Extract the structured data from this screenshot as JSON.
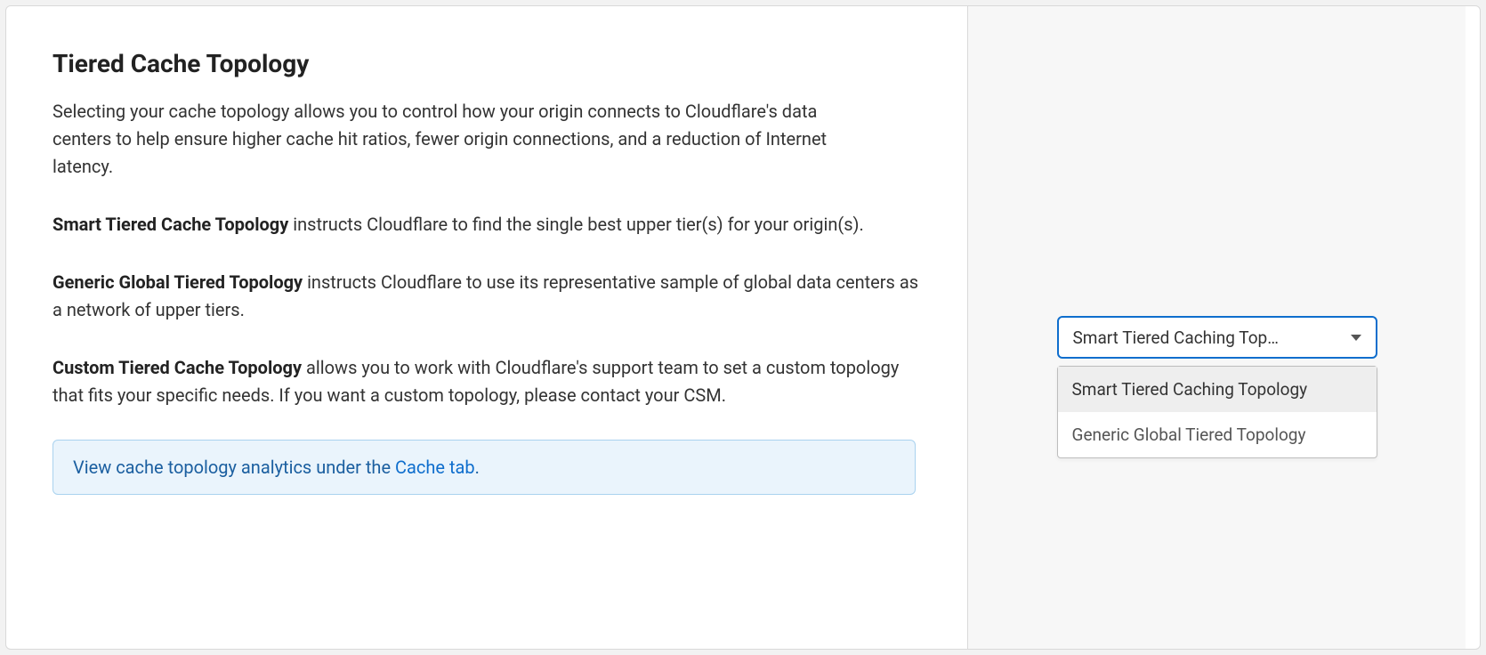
{
  "title": "Tiered Cache Topology",
  "description": "Selecting your cache topology allows you to control how your origin connects to Cloudflare's data centers to help ensure higher cache hit ratios, fewer origin connections, and a reduction of Internet latency.",
  "paragraphs": [
    {
      "bold": "Smart Tiered Cache Topology",
      "rest": " instructs Cloudflare to find the single best upper tier(s) for your origin(s)."
    },
    {
      "bold": "Generic Global Tiered Topology",
      "rest": " instructs Cloudflare to use its representative sample of global data centers as a network of upper tiers."
    },
    {
      "bold": "Custom Tiered Cache Topology",
      "rest": " allows you to work with Cloudflare's support team to set a custom topology that fits your specific needs. If you want a custom topology, please contact your CSM."
    }
  ],
  "banner": {
    "prefix": "View cache topology analytics under the ",
    "link_text": "Cache tab",
    "suffix": "."
  },
  "select": {
    "display": "Smart Tiered Caching Top…",
    "options": [
      {
        "label": "Smart Tiered Caching Topology",
        "selected": true
      },
      {
        "label": "Generic Global Tiered Topology",
        "selected": false
      }
    ]
  }
}
